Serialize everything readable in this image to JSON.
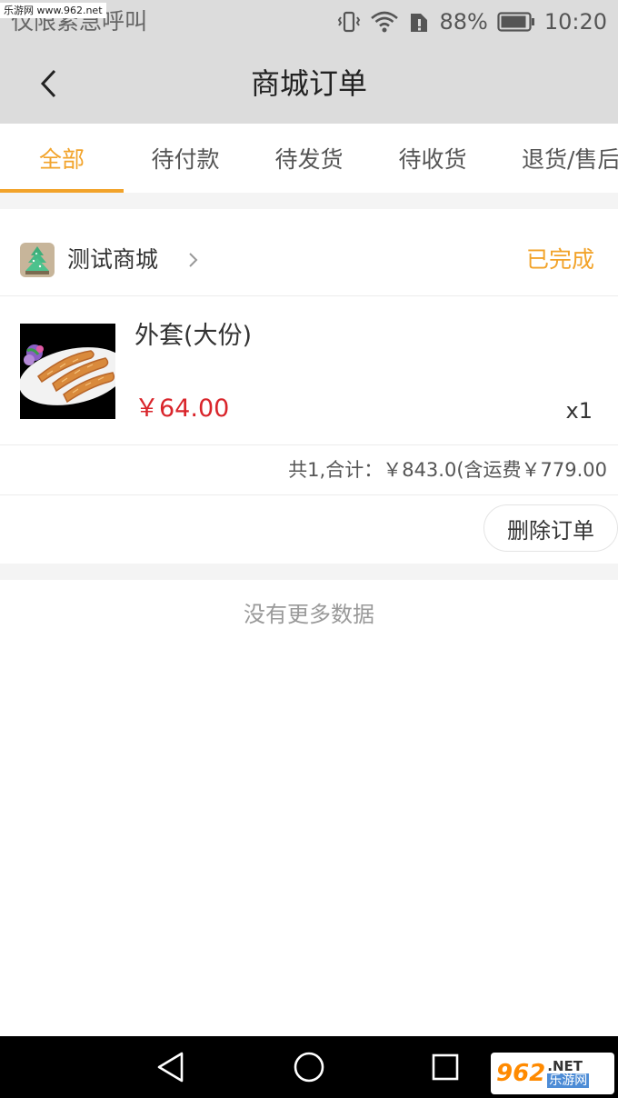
{
  "watermark_top": "乐游网 www.962.net",
  "status_bar": {
    "carrier": "仅限紧急呼叫",
    "battery": "88%",
    "time": "10:20",
    "icons": [
      "vibrate-icon",
      "wifi-icon",
      "sim-alert-icon",
      "battery-icon"
    ]
  },
  "header": {
    "title": "商城订单",
    "back_icon": "chevron-left-icon"
  },
  "tabs": [
    {
      "label": "全部",
      "active": true
    },
    {
      "label": "待付款",
      "active": false
    },
    {
      "label": "待发货",
      "active": false
    },
    {
      "label": "待收货",
      "active": false
    },
    {
      "label": "退货/售后",
      "active": false
    }
  ],
  "order": {
    "shop_name": "测试商城",
    "status": "已完成",
    "item": {
      "name": "外套(大份)",
      "price": "￥64.00",
      "quantity": "x1"
    },
    "summary": "共1,合计：￥843.0(含运费￥779.00",
    "delete_label": "删除订单"
  },
  "no_more_text": "没有更多数据",
  "watermark_bottom": {
    "big": "962",
    "net": ".NET",
    "cn": "乐游网"
  },
  "colors": {
    "accent": "#f2a32a",
    "price": "#d9252b",
    "header_bg": "#dcdcdc"
  }
}
